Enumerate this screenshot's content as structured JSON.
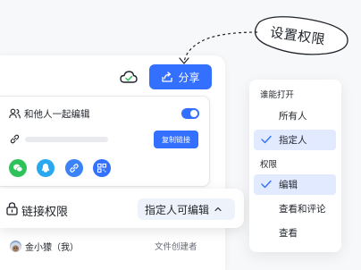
{
  "callout": {
    "text": "设置权限"
  },
  "toolbar": {
    "share_label": "分享"
  },
  "share_panel": {
    "collab_label": "和他人一起编辑",
    "copy_link_label": "复制链接"
  },
  "link_permission": {
    "label": "链接权限",
    "selected_value": "指定人可编辑"
  },
  "owner": {
    "name": "金小獴（我）",
    "role": "文件创建者"
  },
  "menu": {
    "section_who": "谁能打开",
    "who_options": [
      "所有人",
      "指定人"
    ],
    "who_selected": "指定人",
    "section_perm": "权限",
    "perm_options": [
      "编辑",
      "查看和评论",
      "查看"
    ],
    "perm_selected": "编辑"
  },
  "colors": {
    "accent": "#3370ff",
    "selected_bg": "#e1eaff",
    "wechat": "#2fc25b",
    "qq": "#29a8f0"
  },
  "icons": [
    "cloud-check-icon",
    "share-icon",
    "collaborate-icon",
    "link-icon",
    "wechat-icon",
    "qq-icon",
    "copy-link-icon",
    "qr-code-icon",
    "lock-icon",
    "chevron-up-icon",
    "check-icon"
  ]
}
